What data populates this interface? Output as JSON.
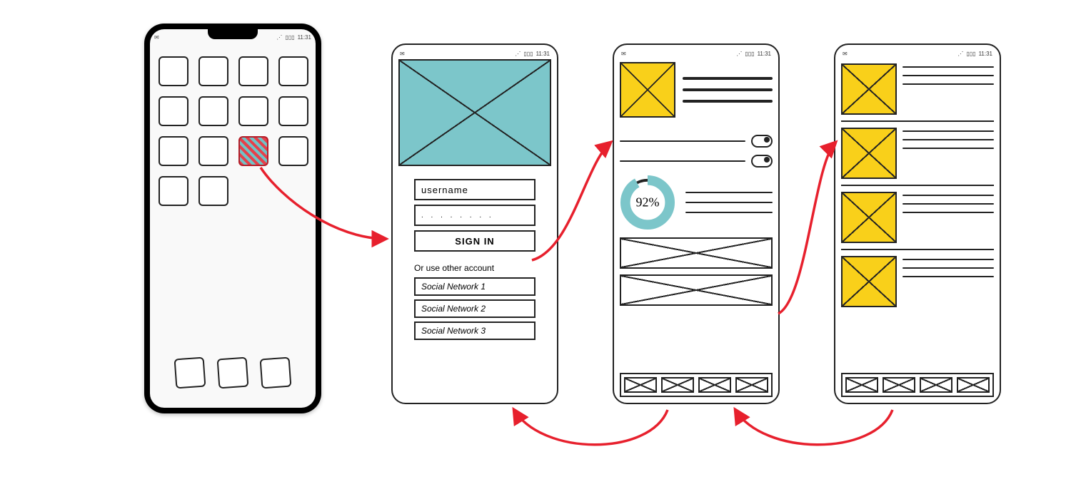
{
  "status": {
    "time": "11:31",
    "wifi_icon": "wifi",
    "signal_icon": "signal",
    "mail_icon": "mail"
  },
  "screen1": {
    "grid_rows": 4,
    "grid_cols": 4,
    "visible_icons": 14,
    "selected_index": 10,
    "dock_icons": 3
  },
  "screen2_login": {
    "username_placeholder": "username",
    "password_mask": ". . . . . . . .",
    "signin_label": "SIGN IN",
    "or_label": "Or use other account",
    "social": [
      "Social Network 1",
      "Social Network 2",
      "Social Network 3"
    ]
  },
  "screen3_dashboard": {
    "header_lines": 3,
    "toggles": 2,
    "gauge_percent": "92%",
    "body_lines": 3,
    "wide_placeholders": 2,
    "tab_count": 4
  },
  "screen4_list": {
    "items": 4,
    "lines_per_item": 3,
    "tab_count": 4
  },
  "colors": {
    "teal": "#7cc6ca",
    "yellow": "#f9d01a",
    "arrow": "#e7202d",
    "ink": "#222222"
  }
}
